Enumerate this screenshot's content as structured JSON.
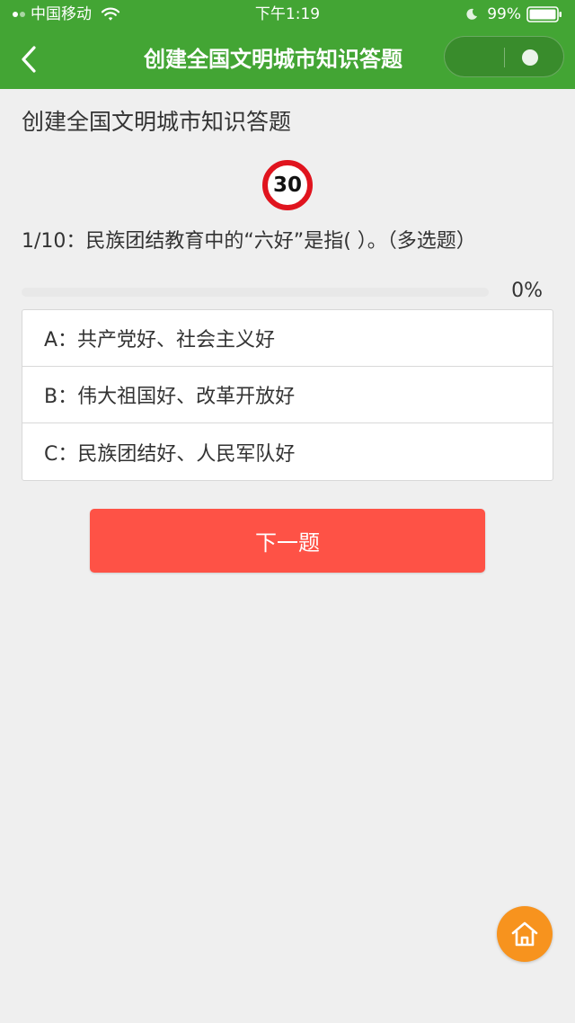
{
  "status_bar": {
    "carrier": "中国移动",
    "time": "下午1:19",
    "battery": "99%"
  },
  "nav": {
    "title": "创建全国文明城市知识答题"
  },
  "quiz": {
    "title": "创建全国文明城市知识答题",
    "timer": "30",
    "question": "1/10：民族团结教育中的“六好”是指( ）。（多选题）",
    "progress_percent": 0,
    "progress_text": "0%",
    "options": [
      {
        "label": "A：共产党好、社会主义好"
      },
      {
        "label": "B：伟大祖国好、改革开放好"
      },
      {
        "label": "C：民族团结好、人民军队好"
      }
    ],
    "next_label": "下一题"
  },
  "colors": {
    "brand_green": "#43a534",
    "next_button": "#fe5246",
    "home_button": "#f7931e",
    "timer_ring": "#e0141e"
  },
  "icons": {
    "back": "chevron-left-icon",
    "home": "home-icon",
    "wifi": "wifi-icon",
    "battery": "battery-icon"
  }
}
